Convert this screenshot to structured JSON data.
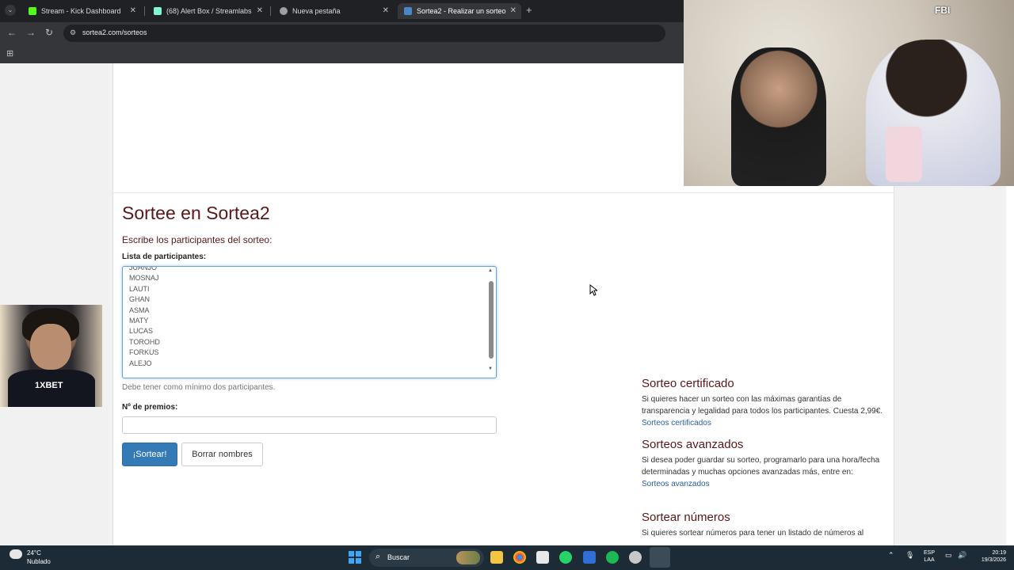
{
  "browser": {
    "tabs": [
      {
        "title": "Stream - Kick Dashboard",
        "favicon_color": "#53fc18"
      },
      {
        "title": "(68) Alert Box / Streamlabs",
        "favicon_color": "#80f5d2"
      },
      {
        "title": "Nueva pestaña",
        "favicon_color": "#9aa0a6"
      },
      {
        "title": "Sortea2 - Realizar un sorteo",
        "favicon_color": "#4a86c5"
      }
    ],
    "url": "sortea2.com/sorteos"
  },
  "page": {
    "title": "Sortee en Sortea2",
    "subtitle": "Escribe los participantes del sorteo:",
    "participants_label": "Lista de participantes:",
    "participants": [
      "JUANJO",
      "MOSNAJ",
      "LAUTI",
      "GHAN",
      "ASMA",
      "MATY",
      "LUCAS",
      "TOROHD",
      "FORKUS",
      "ALEJO"
    ],
    "help_text": "Debe tener como mínimo dos participantes.",
    "prizes_label": "Nº de premios:",
    "prizes_value": "",
    "draw_button": "¡Sortear!",
    "clear_button": "Borrar nombres"
  },
  "sidebar": {
    "certified": {
      "title": "Sorteo certificado",
      "text": "Si quieres hacer un sorteo con las máximas garantías de transparencia y legalidad para todos los participantes. Cuesta 2,99€.",
      "link": "Sorteos certificados"
    },
    "advanced": {
      "title": "Sorteos avanzados",
      "text": "Si desea poder guardar su sorteo, programarlo para una hora/fecha determinadas y muchas opciones avanzadas más, entre en:",
      "link": "Sorteos avanzados"
    },
    "numbers": {
      "title": "Sortear números",
      "text": "Si quieres sortear números para tener un listado de números al"
    }
  },
  "overlays": {
    "webcam_tag": "FBI",
    "shirt_brand": "1XBET"
  },
  "taskbar": {
    "weather_temp": "24°C",
    "weather_condition": "Nublado",
    "search_label": "Buscar",
    "lang_top": "ESP",
    "lang_bottom": "LAA",
    "time": "20:19",
    "date": "19/3/2026"
  }
}
